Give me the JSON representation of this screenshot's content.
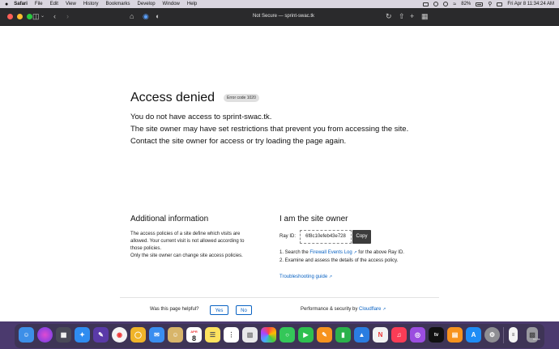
{
  "menubar": {
    "apple": "",
    "items": [
      "Safari",
      "File",
      "Edit",
      "View",
      "History",
      "Bookmarks",
      "Develop",
      "Window",
      "Help"
    ],
    "battery": "82%",
    "datetime": "Fri Apr 8  11:34:24 AM"
  },
  "toolbar": {
    "address": "Not Secure — sprint-swac.tk"
  },
  "page": {
    "title": "Access denied",
    "error_badge": "Error code 1020",
    "lines": [
      "You do not have access to sprint-swac.tk.",
      "The site owner may have set restrictions that prevent you from accessing the site.",
      "Contact the site owner for access or try loading the page again."
    ],
    "additional": {
      "heading": "Additional information",
      "lines": [
        "The access policies of a site define which visits are",
        "allowed. Your current visit is not allowed according to",
        "those policies.",
        "Only the site owner can change site access policies."
      ]
    },
    "owner": {
      "heading": "I am the site owner",
      "ray_label": "Ray ID:",
      "ray_id": "6f8c10efeb43e728",
      "copy": "Copy",
      "step1_prefix": "1. Search the",
      "step1_link": "Firewall Events Log",
      "step1_suffix": "for the above Ray ID.",
      "step2": "2. Examine and assess the details of the access policy.",
      "troubleshooting": "Troubleshooting guide"
    },
    "footer": {
      "helpful": "Was this page helpful?",
      "yes": "Yes",
      "no": "No",
      "perf_prefix": "Performance & security by",
      "perf_link": "Cloudflare"
    }
  },
  "dock": {
    "calendar_month": "APR",
    "calendar_day": "8",
    "tv_label": "tv",
    "items_label": "tems"
  }
}
